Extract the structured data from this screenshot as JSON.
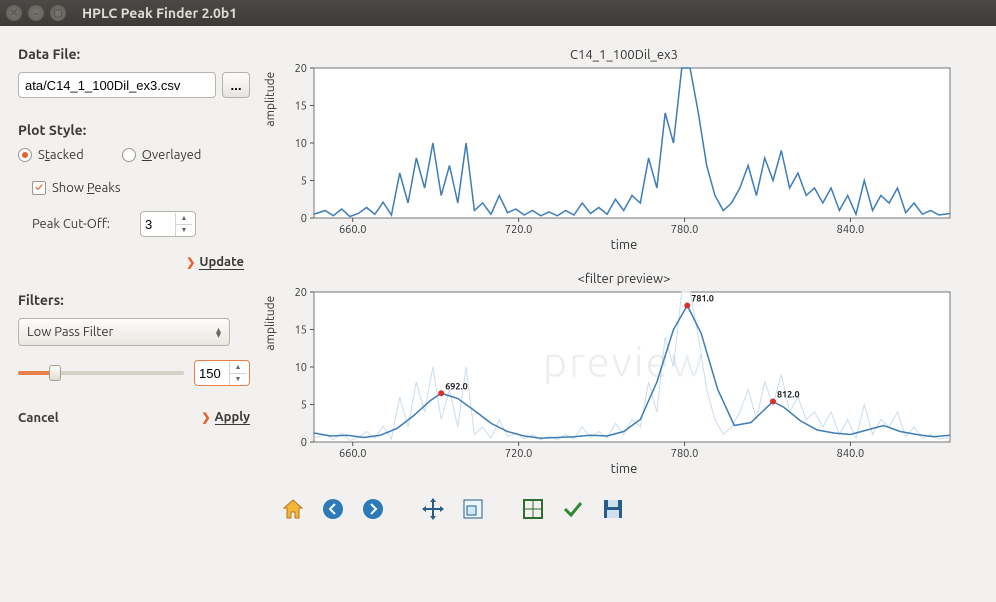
{
  "window": {
    "title": "HPLC Peak Finder 2.0b1"
  },
  "left": {
    "data_file_header": "Data File:",
    "data_file_value": "ata/C14_1_100Dil_ex3.csv",
    "browse_label": "...",
    "plot_style_header": "Plot Style:",
    "stacked_label_pre": "S",
    "stacked_label_u": "t",
    "stacked_label_post": "acked",
    "overlayed_label_pre": "",
    "overlayed_label_u": "O",
    "overlayed_label_post": "verlayed",
    "show_peaks_pre": "Show ",
    "show_peaks_u": "P",
    "show_peaks_post": "eaks",
    "peak_cutoff_label": "Peak Cut-Off:",
    "peak_cutoff_value": "3",
    "update_label": "Update",
    "filters_header": "Filters:",
    "filter_selected": "Low Pass Filter",
    "slider_value": "150",
    "cancel_label": "Cancel",
    "apply_label": "Apply"
  },
  "toolbar": {
    "home": "home-icon",
    "back": "back-icon",
    "forward": "forward-icon",
    "pan": "pan-icon",
    "zoom": "zoom-icon",
    "subplots": "subplots-icon",
    "edit": "edit-icon",
    "save": "save-icon"
  },
  "chart_data": [
    {
      "type": "line",
      "title": "C14_1_100Dil_ex3",
      "xlabel": "time",
      "ylabel": "amplitude",
      "xlim": [
        646,
        876
      ],
      "ylim": [
        0,
        20
      ],
      "xticks": [
        660.0,
        720.0,
        780.0,
        840.0
      ],
      "yticks": [
        0,
        5,
        10,
        15,
        20
      ],
      "series": [
        {
          "name": "raw",
          "x": [
            646,
            650,
            653,
            656,
            659,
            662,
            665,
            668,
            671,
            674,
            677,
            680,
            683,
            686,
            689,
            692,
            695,
            698,
            701,
            704,
            707,
            710,
            713,
            716,
            719,
            722,
            725,
            728,
            731,
            734,
            737,
            740,
            743,
            746,
            749,
            752,
            755,
            758,
            761,
            764,
            767,
            770,
            773,
            776,
            779,
            782,
            785,
            788,
            791,
            794,
            797,
            800,
            803,
            806,
            809,
            812,
            815,
            818,
            821,
            824,
            827,
            830,
            833,
            836,
            839,
            842,
            845,
            848,
            851,
            854,
            857,
            860,
            863,
            866,
            869,
            872,
            876
          ],
          "y": [
            0.5,
            1,
            0.3,
            1.2,
            0.2,
            0.6,
            1.4,
            0.5,
            2.1,
            0.4,
            6,
            2,
            8,
            4,
            10,
            3,
            7,
            2,
            10,
            1,
            2,
            0.5,
            3,
            0.7,
            1.2,
            0.4,
            1,
            0.3,
            0.8,
            0.3,
            1.0,
            0.4,
            2,
            0.6,
            1.4,
            0.5,
            2.5,
            1,
            3,
            2,
            8,
            4,
            14,
            10,
            20,
            21,
            14,
            7,
            3,
            1,
            2,
            4,
            7,
            3,
            8,
            5,
            9,
            4,
            6,
            3,
            4,
            2,
            4,
            1,
            3,
            0.5,
            5,
            1,
            3,
            2,
            4,
            0.7,
            2,
            0.5,
            1,
            0.4,
            0.6
          ]
        }
      ]
    },
    {
      "type": "line",
      "title": "<filter preview>",
      "xlabel": "time",
      "ylabel": "amplitude",
      "xlim": [
        646,
        876
      ],
      "ylim": [
        0,
        20
      ],
      "xticks": [
        660.0,
        720.0,
        780.0,
        840.0
      ],
      "yticks": [
        0,
        5,
        10,
        15,
        20
      ],
      "watermark": "preview",
      "peaks": [
        {
          "x": 692.0,
          "y": 6.5,
          "label": "692.0"
        },
        {
          "x": 781.0,
          "y": 18.2,
          "label": "781.0"
        },
        {
          "x": 812.0,
          "y": 5.4,
          "label": "812.0"
        }
      ],
      "series": [
        {
          "name": "raw-ghost",
          "x": [
            646,
            650,
            653,
            656,
            659,
            662,
            665,
            668,
            671,
            674,
            677,
            680,
            683,
            686,
            689,
            692,
            695,
            698,
            701,
            704,
            707,
            710,
            713,
            716,
            719,
            722,
            725,
            728,
            731,
            734,
            737,
            740,
            743,
            746,
            749,
            752,
            755,
            758,
            761,
            764,
            767,
            770,
            773,
            776,
            779,
            782,
            785,
            788,
            791,
            794,
            797,
            800,
            803,
            806,
            809,
            812,
            815,
            818,
            821,
            824,
            827,
            830,
            833,
            836,
            839,
            842,
            845,
            848,
            851,
            854,
            857,
            860,
            863,
            866,
            869,
            872,
            876
          ],
          "y": [
            0.5,
            1,
            0.3,
            1.2,
            0.2,
            0.6,
            1.4,
            0.5,
            2.1,
            0.4,
            6,
            2,
            8,
            4,
            10,
            3,
            7,
            2,
            10,
            1,
            2,
            0.5,
            3,
            0.7,
            1.2,
            0.4,
            1,
            0.3,
            0.8,
            0.3,
            1.0,
            0.4,
            2,
            0.6,
            1.4,
            0.5,
            2.5,
            1,
            3,
            2,
            8,
            4,
            14,
            10,
            20,
            21,
            14,
            7,
            3,
            1,
            2,
            4,
            7,
            3,
            8,
            5,
            9,
            4,
            6,
            3,
            4,
            2,
            4,
            1,
            3,
            0.5,
            5,
            1,
            3,
            2,
            4,
            0.7,
            2,
            0.5,
            1,
            0.4,
            0.6
          ]
        },
        {
          "name": "filtered",
          "x": [
            646,
            652,
            658,
            664,
            670,
            676,
            682,
            688,
            692,
            698,
            704,
            710,
            716,
            722,
            728,
            734,
            740,
            746,
            752,
            758,
            764,
            770,
            776,
            781,
            786,
            792,
            798,
            804,
            808,
            812,
            816,
            822,
            828,
            834,
            840,
            846,
            852,
            858,
            864,
            870,
            876
          ],
          "y": [
            1.2,
            0.8,
            0.9,
            0.6,
            0.9,
            1.8,
            3.5,
            5.5,
            6.5,
            5.8,
            4.2,
            2.5,
            1.4,
            0.8,
            0.5,
            0.6,
            0.7,
            0.9,
            0.8,
            1.4,
            3.0,
            8.0,
            15.0,
            18.2,
            14.5,
            7.0,
            2.2,
            2.6,
            4.0,
            5.4,
            4.6,
            2.8,
            1.6,
            1.2,
            1.0,
            1.6,
            2.2,
            1.4,
            1.0,
            0.7,
            0.9
          ]
        }
      ]
    }
  ]
}
